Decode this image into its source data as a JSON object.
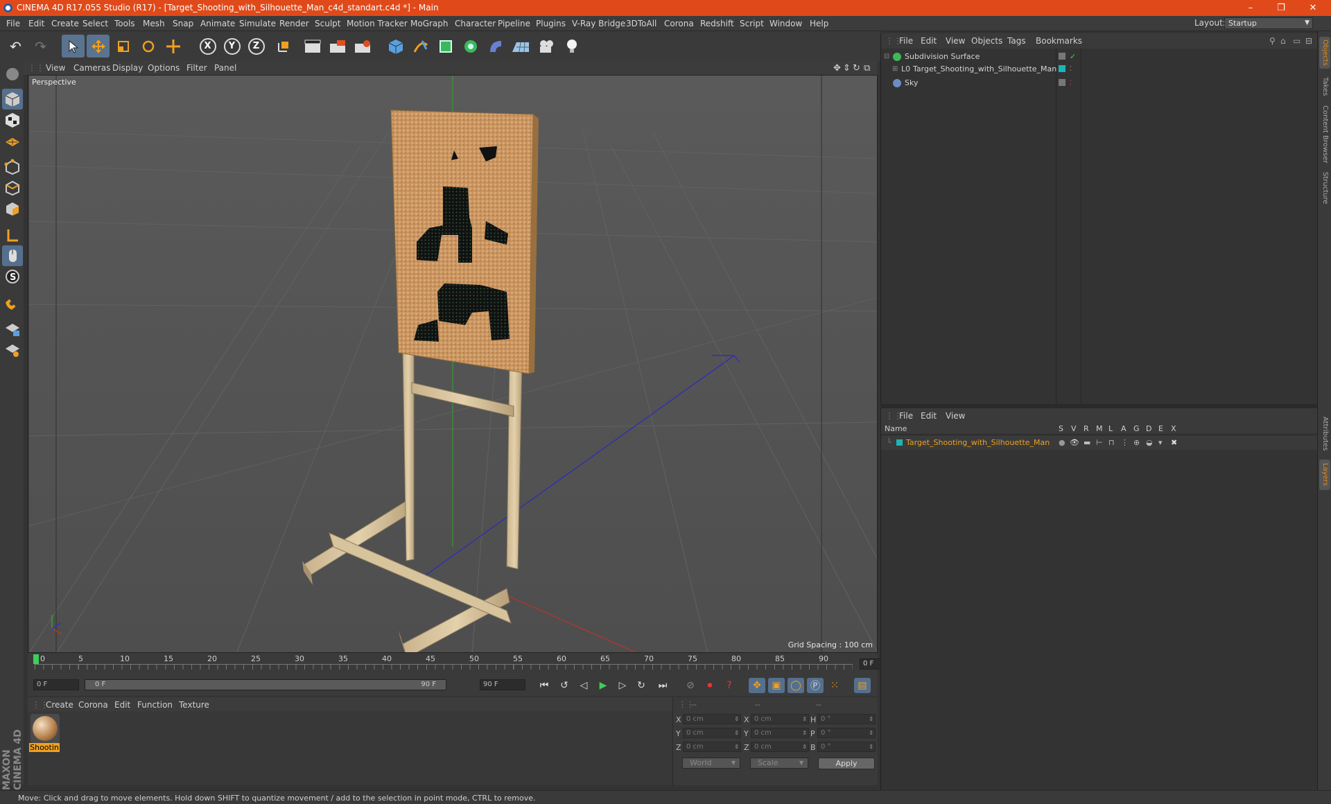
{
  "window": {
    "title": "CINEMA 4D R17.055 Studio (R17) - [Target_Shooting_with_Silhouette_Man_c4d_standart.c4d *] - Main",
    "minimize": "–",
    "restore": "❐",
    "close": "✕"
  },
  "menu": [
    "File",
    "Edit",
    "Create",
    "Select",
    "Tools",
    "Mesh",
    "Snap",
    "Animate",
    "Simulate",
    "Render",
    "Sculpt",
    "Motion Tracker",
    "MoGraph",
    "Character",
    "Pipeline",
    "Plugins",
    "V-Ray Bridge",
    "3DToAll",
    "Corona",
    "Redshift",
    "Script",
    "Window",
    "Help"
  ],
  "layout": {
    "label": "Layout:",
    "value": "Startup"
  },
  "toolbar": {
    "axis_x": "X",
    "axis_y": "Y",
    "axis_z": "Z"
  },
  "viewport": {
    "menu": [
      "View",
      "Cameras",
      "Display",
      "Options",
      "Filter",
      "Panel"
    ],
    "label": "Perspective",
    "grid_spacing": "Grid Spacing : 100 cm"
  },
  "timeline": {
    "ticks": [
      "0",
      "5",
      "10",
      "15",
      "20",
      "25",
      "30",
      "35",
      "40",
      "45",
      "50",
      "55",
      "60",
      "65",
      "70",
      "75",
      "80",
      "85",
      "90"
    ],
    "current_frame": "0 F"
  },
  "playback": {
    "start": "0 F",
    "range_start": "0 F",
    "range_end": "90 F",
    "end": "90 F"
  },
  "materials": {
    "menu": [
      "Create",
      "Corona",
      "Edit",
      "Function",
      "Texture"
    ],
    "items": [
      {
        "name": "Shootin"
      }
    ]
  },
  "coordinates": {
    "headers": [
      "--",
      "--",
      "--"
    ],
    "rows": [
      {
        "a": "X",
        "av": "0 cm",
        "b": "X",
        "bv": "0 cm",
        "c": "H",
        "cv": "0 °"
      },
      {
        "a": "Y",
        "av": "0 cm",
        "b": "Y",
        "bv": "0 cm",
        "c": "P",
        "cv": "0 °"
      },
      {
        "a": "Z",
        "av": "0 cm",
        "b": "Z",
        "bv": "0 cm",
        "c": "B",
        "cv": "0 °"
      }
    ],
    "mode": "World",
    "size_mode": "Scale",
    "apply": "Apply"
  },
  "objects": {
    "menu": [
      "File",
      "Edit",
      "View",
      "Objects",
      "Tags",
      "Bookmarks"
    ],
    "items": [
      {
        "name": "Subdivision Surface"
      },
      {
        "name": "Target_Shooting_with_Silhouette_Man"
      },
      {
        "name": "Sky"
      }
    ]
  },
  "layers": {
    "menu": [
      "File",
      "Edit",
      "View"
    ],
    "columns": [
      "Name",
      "S",
      "V",
      "R",
      "M",
      "L",
      "A",
      "G",
      "D",
      "E",
      "X"
    ],
    "items": [
      {
        "name": "Target_Shooting_with_Silhouette_Man"
      }
    ]
  },
  "right_tabs": [
    "Objects",
    "Takes",
    "Content Browser",
    "Structure",
    "Attributes",
    "Layers"
  ],
  "status": "Move: Click and drag to move elements. Hold down SHIFT to quantize movement / add to the selection in point mode, CTRL to remove.",
  "branding": "MAXON CINEMA 4D",
  "colors": {
    "title_bar": "#e04a1a",
    "accent": "#f0a020",
    "layer_teal": "#1bb5b5"
  }
}
